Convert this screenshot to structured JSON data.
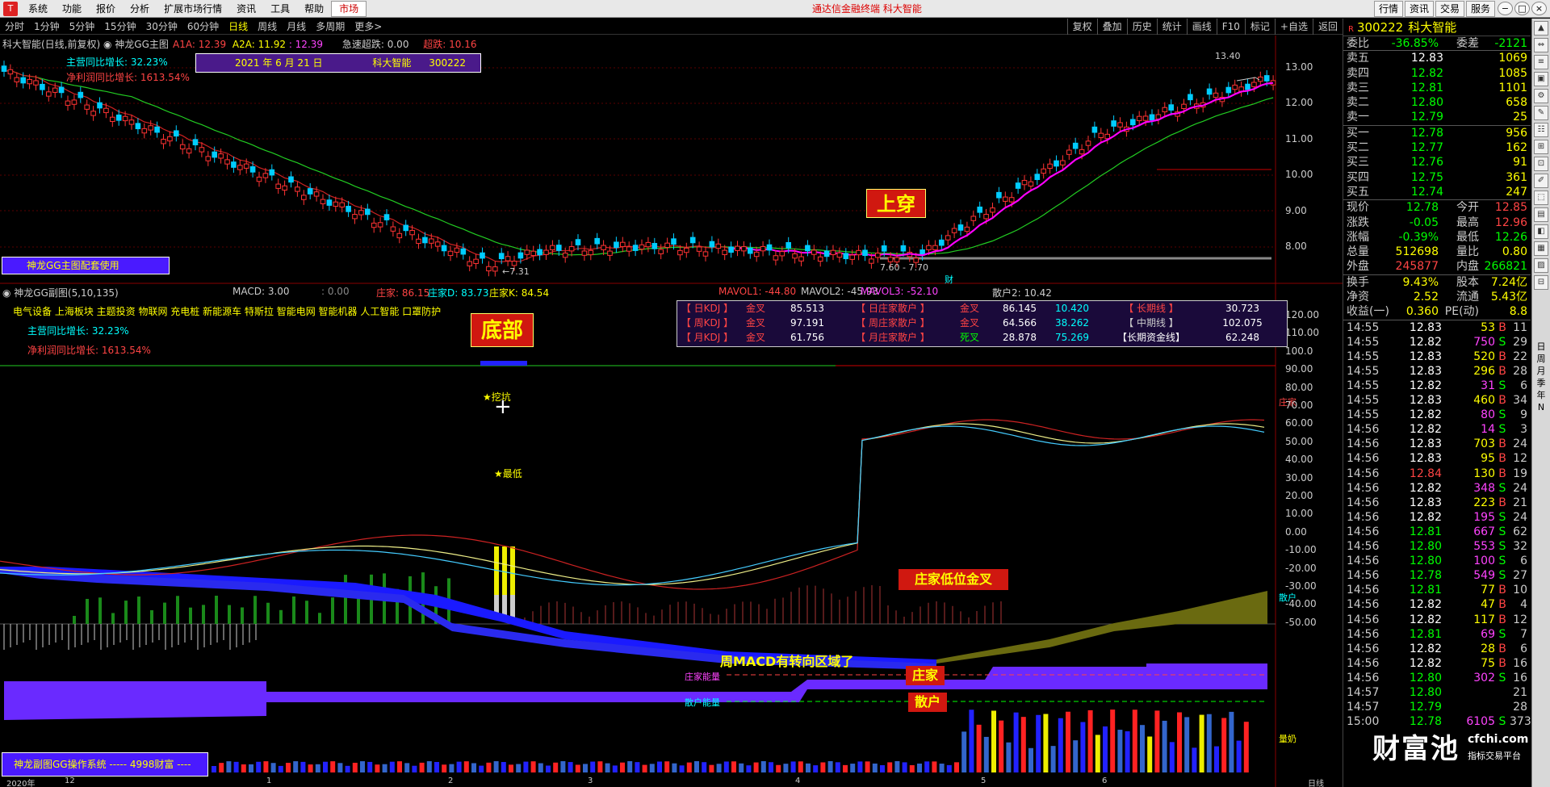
{
  "menu": {
    "items": [
      "系统",
      "功能",
      "报价",
      "分析",
      "扩展市场行情",
      "资讯",
      "工具",
      "帮助"
    ],
    "active": "市场",
    "app_title": "通达信金融终端 科大智能",
    "right_buttons": [
      "行情",
      "资讯",
      "交易",
      "服务"
    ],
    "window_controls": [
      "−",
      "□",
      "×"
    ]
  },
  "period_bar": {
    "items": [
      "分时",
      "1分钟",
      "5分钟",
      "15分钟",
      "30分钟",
      "60分钟",
      "日线",
      "周线",
      "月线",
      "多周期",
      "更多>"
    ],
    "selected": "日线",
    "tools": [
      "复权",
      "叠加",
      "历史",
      "统计",
      "画线",
      "F10",
      "标记",
      "+自选",
      "返回"
    ]
  },
  "main_chart": {
    "title": "科大智能(日线,前复权) ◉ 神龙GG主图",
    "a1a_label": "A1A:",
    "a1a": "12.39",
    "a2a_label": "A2A:",
    "a2a": "11.92",
    "a2a_extra": ": 12.39",
    "jzcd_label": "急速超跌:",
    "jzcd": "0.00",
    "cd_label": "超跌:",
    "cd": "10.16",
    "info_date": "2021 年 6 月 21 日",
    "info_name": "科大智能",
    "info_code": "300222",
    "growth1": "主营同比增长: 32.23%",
    "growth2": "净利润同比增长: 1613.54%",
    "peak_label": "13.40",
    "low_label": "←7.31",
    "range_label": "7.60 - 7.70",
    "cai_label": "财",
    "shangchuan": "上穿",
    "purple_box": "神龙GG主图配套使用",
    "yticks": [
      "13.00",
      "12.00",
      "11.00",
      "10.00",
      "9.00",
      "8.00"
    ]
  },
  "sub_chart": {
    "title": "◉ 神龙GG副图(5,10,135)",
    "macd": "MACD: 3.00",
    "macd2": ": 0.00",
    "zj": "庄家: 86.15",
    "zjd": "庄家D: 83.73",
    "zjk": "庄家K: 84.54",
    "mavol1": "MAVOL1: -44.80",
    "mavol2": "MAVOL2: -45.93",
    "mavol3": "MAVOL3: -52.10",
    "sanhu2": "散户2: 10.42",
    "sectors": "电气设备 上海板块 主题投资 物联网 充电桩 新能源车 特斯拉 智能电网 智能机器 人工智能 口罩防护",
    "growth1": "主营同比增长: 32.23%",
    "growth2": "净利润同比增长: 1613.54%",
    "dibu": "底部",
    "wakeng": "★挖坑",
    "zuidi": "★最低",
    "zj_cross": "庄家低位金叉",
    "week_macd": "周MACD有转向区域了",
    "zj_energy": "庄家能量",
    "sh_energy": "散户能量",
    "zj_box": "庄家",
    "sh_box": "散户",
    "right_zj": "庄家",
    "right_sh": "散户",
    "right_vol": "量奶",
    "bottom_box": "神龙副图GG操作系统 ----- 4998财富 ----",
    "yticks": [
      "120.00",
      "110.00",
      "100.0",
      "90.00",
      "80.00",
      "70.00",
      "60.00",
      "50.00",
      "40.00",
      "30.00",
      "20.00",
      "10.00",
      "0.00",
      "-10.00",
      "-20.00",
      "-30.00",
      "-40.00",
      "-50.00"
    ],
    "date_labels": [
      "2020年",
      "12",
      "1",
      "2",
      "3",
      "4",
      "5",
      "6",
      "日线"
    ]
  },
  "kdj_table": [
    {
      "c1": "【 日KDJ 】",
      "c2": "金叉",
      "c3": "85.513",
      "c4": "【 日庄家散户 】",
      "c5": "金叉",
      "c6": "86.145",
      "c7": "10.420",
      "c8": "【 长期线 】",
      "c9": "30.723"
    },
    {
      "c1": "【 周KDJ 】",
      "c2": "金叉",
      "c3": "97.191",
      "c4": "【 周庄家散户 】",
      "c5": "金叉",
      "c6": "64.566",
      "c7": "38.262",
      "c8": "【 中期线 】",
      "c9": "102.075"
    },
    {
      "c1": "【 月KDJ 】",
      "c2": "金叉",
      "c3": "61.756",
      "c4": "【 月庄家散户 】",
      "c5": "死叉",
      "c6": "28.878",
      "c7": "75.269",
      "c8": "【长期资金线】",
      "c9": "62.248"
    }
  ],
  "quote": {
    "r": "R",
    "code": "300222",
    "name": "科大智能",
    "weibi_l": "委比",
    "weibi": "-36.85%",
    "weicha_l": "委差",
    "weicha": "-2121",
    "sell": [
      {
        "l": "卖五",
        "p": "12.83",
        "v": "1069"
      },
      {
        "l": "卖四",
        "p": "12.82",
        "v": "1085"
      },
      {
        "l": "卖三",
        "p": "12.81",
        "v": "1101"
      },
      {
        "l": "卖二",
        "p": "12.80",
        "v": "658"
      },
      {
        "l": "卖一",
        "p": "12.79",
        "v": "25"
      }
    ],
    "buy": [
      {
        "l": "买一",
        "p": "12.78",
        "v": "956"
      },
      {
        "l": "买二",
        "p": "12.77",
        "v": "162"
      },
      {
        "l": "买三",
        "p": "12.76",
        "v": "91"
      },
      {
        "l": "买四",
        "p": "12.75",
        "v": "361"
      },
      {
        "l": "买五",
        "p": "12.74",
        "v": "247"
      }
    ],
    "stats": [
      {
        "a": "现价",
        "b": "12.78",
        "c": "今开",
        "d": "12.85"
      },
      {
        "a": "涨跌",
        "b": "-0.05",
        "c": "最高",
        "d": "12.96"
      },
      {
        "a": "涨幅",
        "b": "-0.39%",
        "c": "最低",
        "d": "12.26"
      },
      {
        "a": "总量",
        "b": "512698",
        "c": "量比",
        "d": "0.80"
      },
      {
        "a": "外盘",
        "b": "245877",
        "c": "内盘",
        "d": "266821"
      }
    ],
    "stats2": [
      {
        "a": "换手",
        "b": "9.43%",
        "c": "股本",
        "d": "7.24亿"
      },
      {
        "a": "净资",
        "b": "2.52",
        "c": "流通",
        "d": "5.43亿"
      },
      {
        "a": "收益(一)",
        "b": "0.360",
        "c": "PE(动)",
        "d": "8.8"
      }
    ],
    "ticks": [
      [
        "14:55",
        "12.83",
        "53",
        "B",
        "11"
      ],
      [
        "14:55",
        "12.82",
        "750",
        "S",
        "29"
      ],
      [
        "14:55",
        "12.83",
        "520",
        "B",
        "22"
      ],
      [
        "14:55",
        "12.83",
        "296",
        "B",
        "28"
      ],
      [
        "14:55",
        "12.82",
        "31",
        "S",
        "6"
      ],
      [
        "14:55",
        "12.83",
        "460",
        "B",
        "34"
      ],
      [
        "14:55",
        "12.82",
        "80",
        "S",
        "9"
      ],
      [
        "14:56",
        "12.82",
        "14",
        "S",
        "3"
      ],
      [
        "14:56",
        "12.83",
        "703",
        "B",
        "24"
      ],
      [
        "14:56",
        "12.83",
        "95",
        "B",
        "12"
      ],
      [
        "14:56",
        "12.84",
        "130",
        "B",
        "19"
      ],
      [
        "14:56",
        "12.82",
        "348",
        "S",
        "24"
      ],
      [
        "14:56",
        "12.83",
        "223",
        "B",
        "21"
      ],
      [
        "14:56",
        "12.82",
        "195",
        "S",
        "24"
      ],
      [
        "14:56",
        "12.81",
        "667",
        "S",
        "62"
      ],
      [
        "14:56",
        "12.80",
        "553",
        "S",
        "32"
      ],
      [
        "14:56",
        "12.80",
        "100",
        "S",
        "6"
      ],
      [
        "14:56",
        "12.78",
        "549",
        "S",
        "27"
      ],
      [
        "14:56",
        "12.81",
        "77",
        "B",
        "10"
      ],
      [
        "14:56",
        "12.82",
        "47",
        "B",
        "4"
      ],
      [
        "14:56",
        "12.82",
        "117",
        "B",
        "12"
      ],
      [
        "14:56",
        "12.81",
        "69",
        "S",
        "7"
      ],
      [
        "14:56",
        "12.82",
        "28",
        "B",
        "6"
      ],
      [
        "14:56",
        "12.82",
        "75",
        "B",
        "16"
      ],
      [
        "14:56",
        "12.80",
        "302",
        "S",
        "16"
      ],
      [
        "14:57",
        "12.80",
        "",
        "",
        "21"
      ],
      [
        "14:57",
        "12.79",
        "",
        "",
        "28"
      ],
      [
        "15:00",
        "12.78",
        "6105",
        "S",
        "373"
      ]
    ]
  },
  "side": {
    "buttons": [
      "▲",
      "⇔",
      "≡",
      "▣",
      "⚙",
      "✎",
      "☷",
      "⊞",
      "⊡",
      "✐",
      "⬚",
      "▤",
      "◧",
      "▦",
      "▨",
      "⊟"
    ],
    "vertical": [
      "日",
      "周",
      "月",
      "季",
      "年",
      "N"
    ]
  },
  "watermark": {
    "big": "财富池",
    "url": "cfchi.com",
    "sub": "指标交易平台"
  }
}
